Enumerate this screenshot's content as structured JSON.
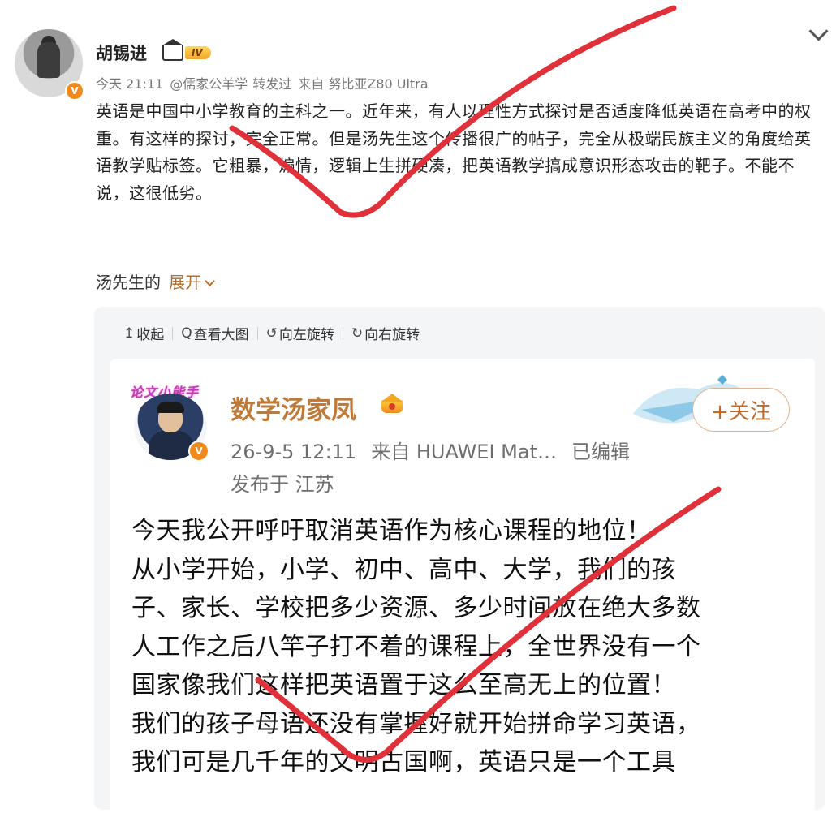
{
  "post": {
    "author": "胡锡进",
    "level_badge": "IV",
    "time": "今天 21:11",
    "mention": "@儒家公羊学",
    "forwarded": "转发过",
    "source": "来自 努比亚Z80 Ultra",
    "text": "英语是中国中小学教育的主科之一。近年来，有人以理性方式探讨是否适度降低英语在高考中的权重。有这样的探讨，完全正常。但是汤先生这个传播很广的帖子，完全从极端民族主义的角度给英语教学贴标签。它粗暴，煽情，逻辑上生拼硬凑，把英语教学搞成意识形态攻击的靶子。不能不说，这很低劣。",
    "expand_prefix": "汤先生的",
    "expand_link": "展开",
    "verified_badge": "V"
  },
  "image_toolbar": {
    "collapse": "收起",
    "view_large": "查看大图",
    "rotate_left": "向左旋转",
    "rotate_right": "向右旋转"
  },
  "quoted": {
    "pendant_text": "论文小能手",
    "name": "数学汤家凤",
    "time": "26-9-5 12:11",
    "source": "来自 HUAWEI Mat…",
    "edited": "已编辑",
    "location": "发布于 江苏",
    "follow_label": "+关注",
    "verified_badge": "V",
    "body_lines": [
      "今天我公开呼吁取消英语作为核心课程的地位！",
      "从小学开始，小学、初中、高中、大学，我们的孩",
      "子、家长、学校把多少资源、多少时间放在绝大多数",
      "人工作之后八竿子打不着的课程上，全世界没有一个",
      "国家像我们这样把英语置于这么至高无上的位置！",
      "我们的孩子母语还没有掌握好就开始拼命学习英语，",
      "我们可是几千年的文明古国啊，英语只是一个工具"
    ]
  },
  "icons": {
    "collapse": "↥",
    "view_large": "Q",
    "rotate_left": "↺",
    "rotate_right": "↻"
  },
  "colors": {
    "accent_link": "#b36b2a",
    "check_mark": "#e0303a",
    "inner_name": "#c07a38"
  }
}
